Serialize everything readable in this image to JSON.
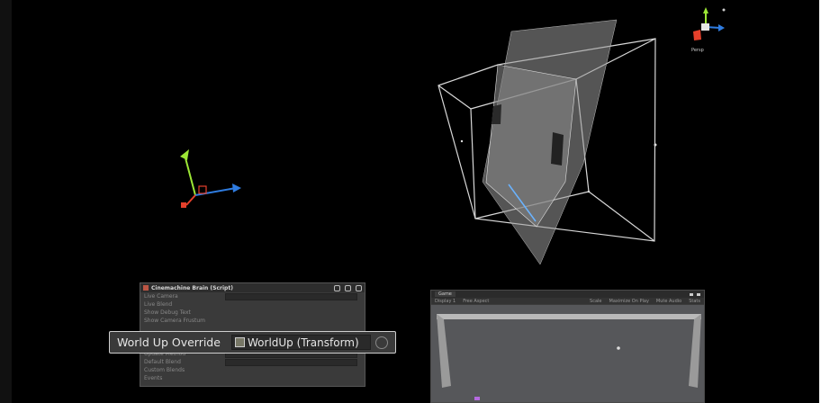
{
  "highlight": {
    "label": "World Up Override",
    "value": "WorldUp (Transform)"
  },
  "inspector": {
    "title": "Cinemachine Brain (Script)",
    "rows": [
      {
        "label": "Live Camera",
        "value": ""
      },
      {
        "label": "Live Blend",
        "value": ""
      },
      {
        "label": "Show Debug Text",
        "value": ""
      },
      {
        "label": "Show Camera Frustum",
        "value": ""
      }
    ],
    "rows_after": [
      {
        "label": "Update Method",
        "value": ""
      },
      {
        "label": "Default Blend",
        "value": ""
      },
      {
        "label": "Custom Blends",
        "value": ""
      },
      {
        "label": "Events",
        "value": ""
      }
    ]
  },
  "game": {
    "tab_label": "Game",
    "display": "Display 1",
    "aspect": "Free Aspect",
    "scale": "Scale",
    "maximize": "Maximize On Play",
    "mute": "Mute Audio",
    "stats": "Stats"
  },
  "gizmo": {
    "view_label": "Persp"
  },
  "colors": {
    "axis_x": "#e5402b",
    "axis_y": "#9ce635",
    "axis_z": "#2f7ce0"
  }
}
